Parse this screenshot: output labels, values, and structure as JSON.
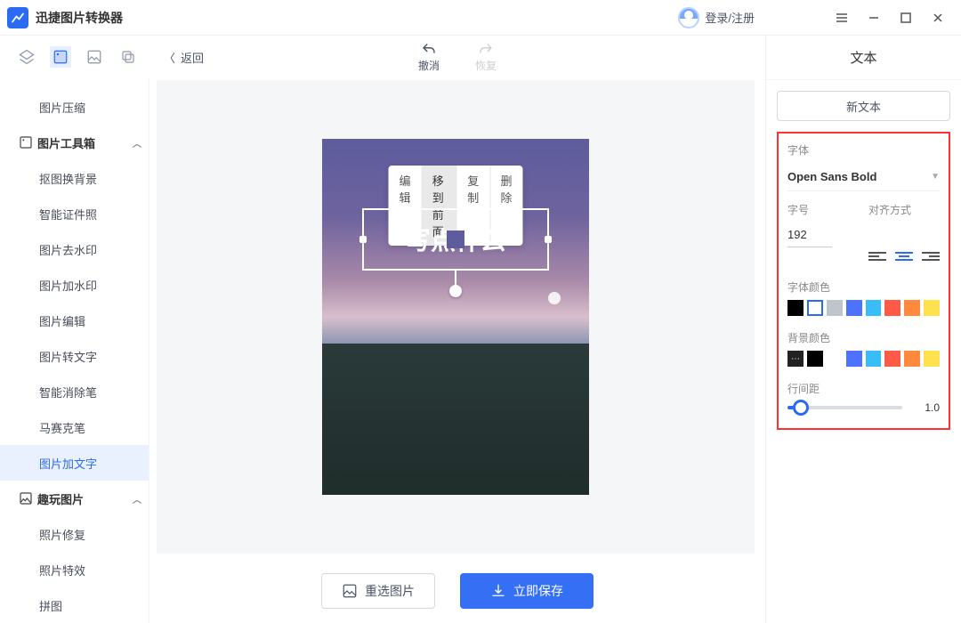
{
  "app": {
    "title": "迅捷图片转换器",
    "login": "登录/注册"
  },
  "sidebar": {
    "item_compress": "图片压缩",
    "group_toolbox": "图片工具箱",
    "items": [
      "抠图换背景",
      "智能证件照",
      "图片去水印",
      "图片加水印",
      "图片编辑",
      "图片转文字",
      "智能消除笔",
      "马赛克笔",
      "图片加文字"
    ],
    "group_fun": "趣玩图片",
    "fun_items": [
      "照片修复",
      "照片特效",
      "拼图"
    ]
  },
  "editor": {
    "back": "返回",
    "undo": "撤消",
    "redo": "恢复",
    "toolbar": {
      "edit": "编辑",
      "front": "移到前面",
      "copy": "复制",
      "del": "删除"
    },
    "placeholder": "写点什么",
    "reselect": "重选图片",
    "save": "立即保存"
  },
  "panel": {
    "title": "文本",
    "new_text": "新文本",
    "font_label": "字体",
    "font_value": "Open Sans Bold",
    "size_label": "字号",
    "size_value": "192",
    "align_label": "对齐方式",
    "font_color_label": "字体颜色",
    "font_colors": [
      "#000000",
      "#ffffff",
      "#bfc5cc",
      "#4d72ff",
      "#38bdf8",
      "#ff5a46",
      "#ff8a3d",
      "#ffe14d"
    ],
    "bg_color_label": "背景颜色",
    "bg_colors": [
      "#000000",
      "#ffffff",
      "#4d72ff",
      "#38bdf8",
      "#ff5a46",
      "#ff8a3d",
      "#ffe14d"
    ],
    "line_label": "行间距",
    "line_value": "1.0"
  }
}
